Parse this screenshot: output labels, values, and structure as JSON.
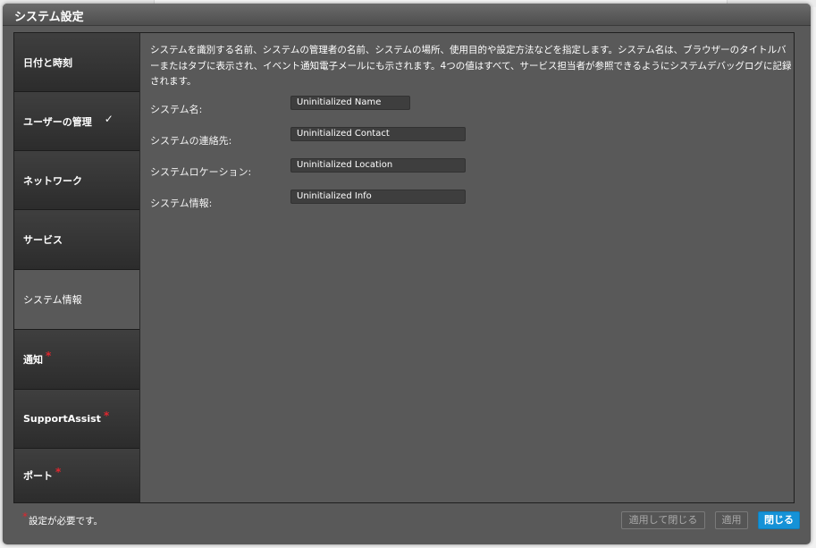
{
  "window": {
    "title": "システム設定"
  },
  "sidebar": {
    "items": [
      {
        "label": "日付と時刻",
        "check": "",
        "required": ""
      },
      {
        "label": "ユーザーの管理",
        "check": "✓",
        "required": ""
      },
      {
        "label": "ネットワーク",
        "check": "",
        "required": ""
      },
      {
        "label": "サービス",
        "check": "",
        "required": ""
      },
      {
        "label": "システム情報",
        "check": "",
        "required": ""
      },
      {
        "label": "通知",
        "check": "",
        "required": "*"
      },
      {
        "label": "SupportAssist",
        "check": "",
        "required": "*"
      },
      {
        "label": "ポート",
        "check": "",
        "required": "*"
      }
    ],
    "active_index": 4
  },
  "main": {
    "description": "システムを識別する名前、システムの管理者の名前、システムの場所、使用目的や設定方法などを指定します。システム名は、ブラウザーのタイトルバーまたはタブに表示され、イベント通知電子メールにも示されます。4つの値はすべて、サービス担当者が参照できるようにシステムデバッグログに記録されます。",
    "fields": [
      {
        "label": "システム名:",
        "value": "Uninitialized Name"
      },
      {
        "label": "システムの連絡先:",
        "value": "Uninitialized Contact"
      },
      {
        "label": "システムロケーション:",
        "value": "Uninitialized Location"
      },
      {
        "label": "システム情報:",
        "value": "Uninitialized Info"
      }
    ]
  },
  "footer": {
    "required_star": "*",
    "required_note": "設定が必要です。",
    "apply_close_label": "適用して閉じる",
    "apply_label": "適用",
    "close_label": "閉じる"
  },
  "colors": {
    "accent": "#1592d7",
    "required": "#e0262e",
    "panel": "#595959",
    "nav": "#333333"
  }
}
